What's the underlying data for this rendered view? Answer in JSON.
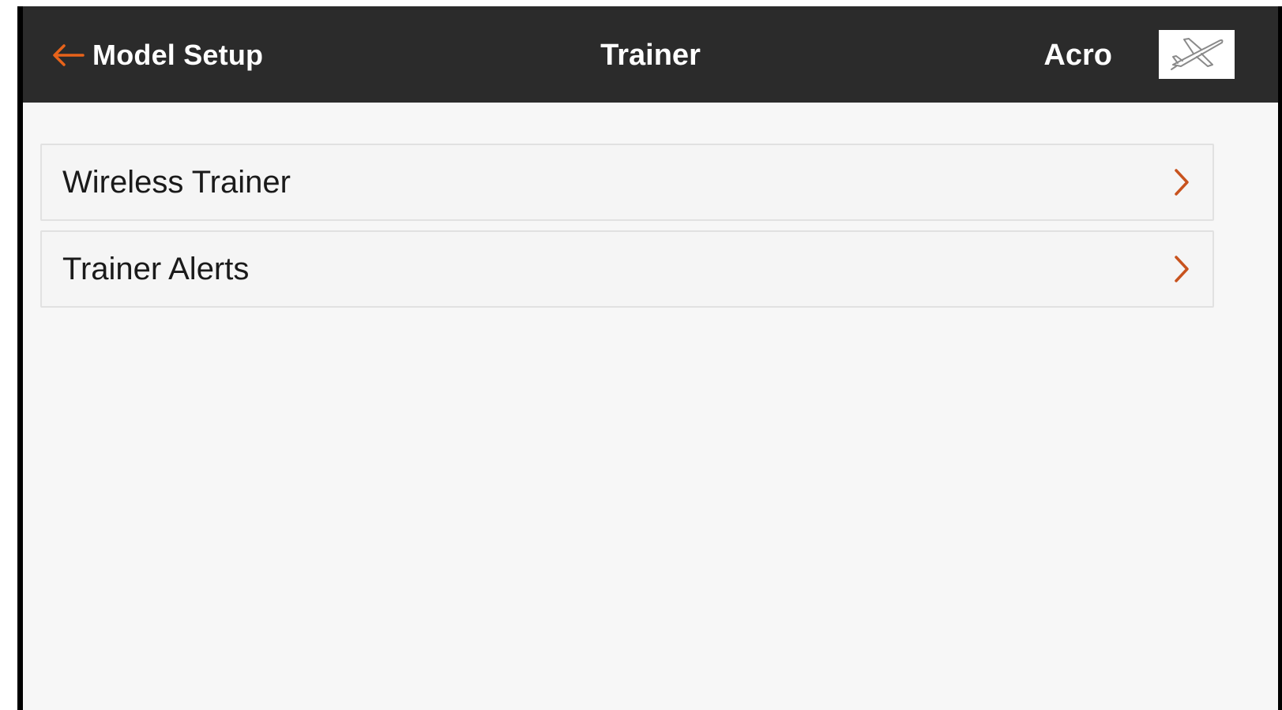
{
  "header": {
    "back_label": "Model Setup",
    "back_icon": "arrow-left-icon",
    "title": "Trainer",
    "mode": "Acro",
    "model_icon": "airplane-icon"
  },
  "menu": {
    "items": [
      {
        "label": "Wireless Trainer",
        "icon": "chevron-right-icon"
      },
      {
        "label": "Trainer Alerts",
        "icon": "chevron-right-icon"
      }
    ]
  },
  "colors": {
    "header_bg": "#2b2b2b",
    "accent": "#e8631a",
    "chevron": "#c8531e",
    "screen_bg": "#f7f7f7",
    "row_border": "#e1e1e1"
  }
}
